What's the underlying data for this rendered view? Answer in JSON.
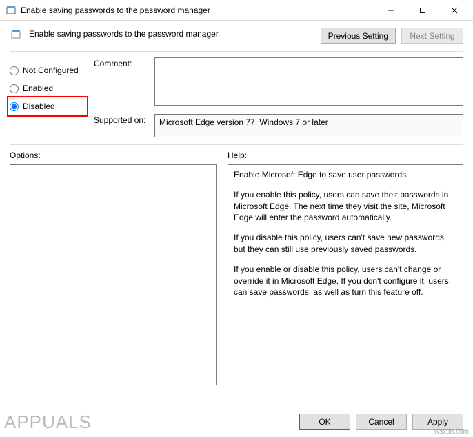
{
  "window": {
    "title": "Enable saving passwords to the password manager"
  },
  "header": {
    "title": "Enable saving passwords to the password manager",
    "previous_button": "Previous Setting",
    "next_button": "Next Setting"
  },
  "policy_state": {
    "options": {
      "not_configured": "Not Configured",
      "enabled": "Enabled",
      "disabled": "Disabled"
    },
    "selected": "disabled"
  },
  "fields": {
    "comment_label": "Comment:",
    "comment_value": "",
    "supported_label": "Supported on:",
    "supported_value": "Microsoft Edge version 77, Windows 7 or later"
  },
  "lower": {
    "options_label": "Options:",
    "help_label": "Help:",
    "help_paragraphs": [
      "Enable Microsoft Edge to save user passwords.",
      "If you enable this policy, users can save their passwords in Microsoft Edge. The next time they visit the site, Microsoft Edge will enter the password automatically.",
      "If you disable this policy, users can't save new passwords, but they can still use previously saved passwords.",
      "If you enable or disable this policy, users can't change or override it in Microsoft Edge. If you don't configure it, users can save passwords, as well as turn this feature off."
    ]
  },
  "footer": {
    "ok": "OK",
    "cancel": "Cancel",
    "apply": "Apply"
  },
  "watermark": {
    "main": "APPUALS",
    "site": "wsxdn.com"
  }
}
